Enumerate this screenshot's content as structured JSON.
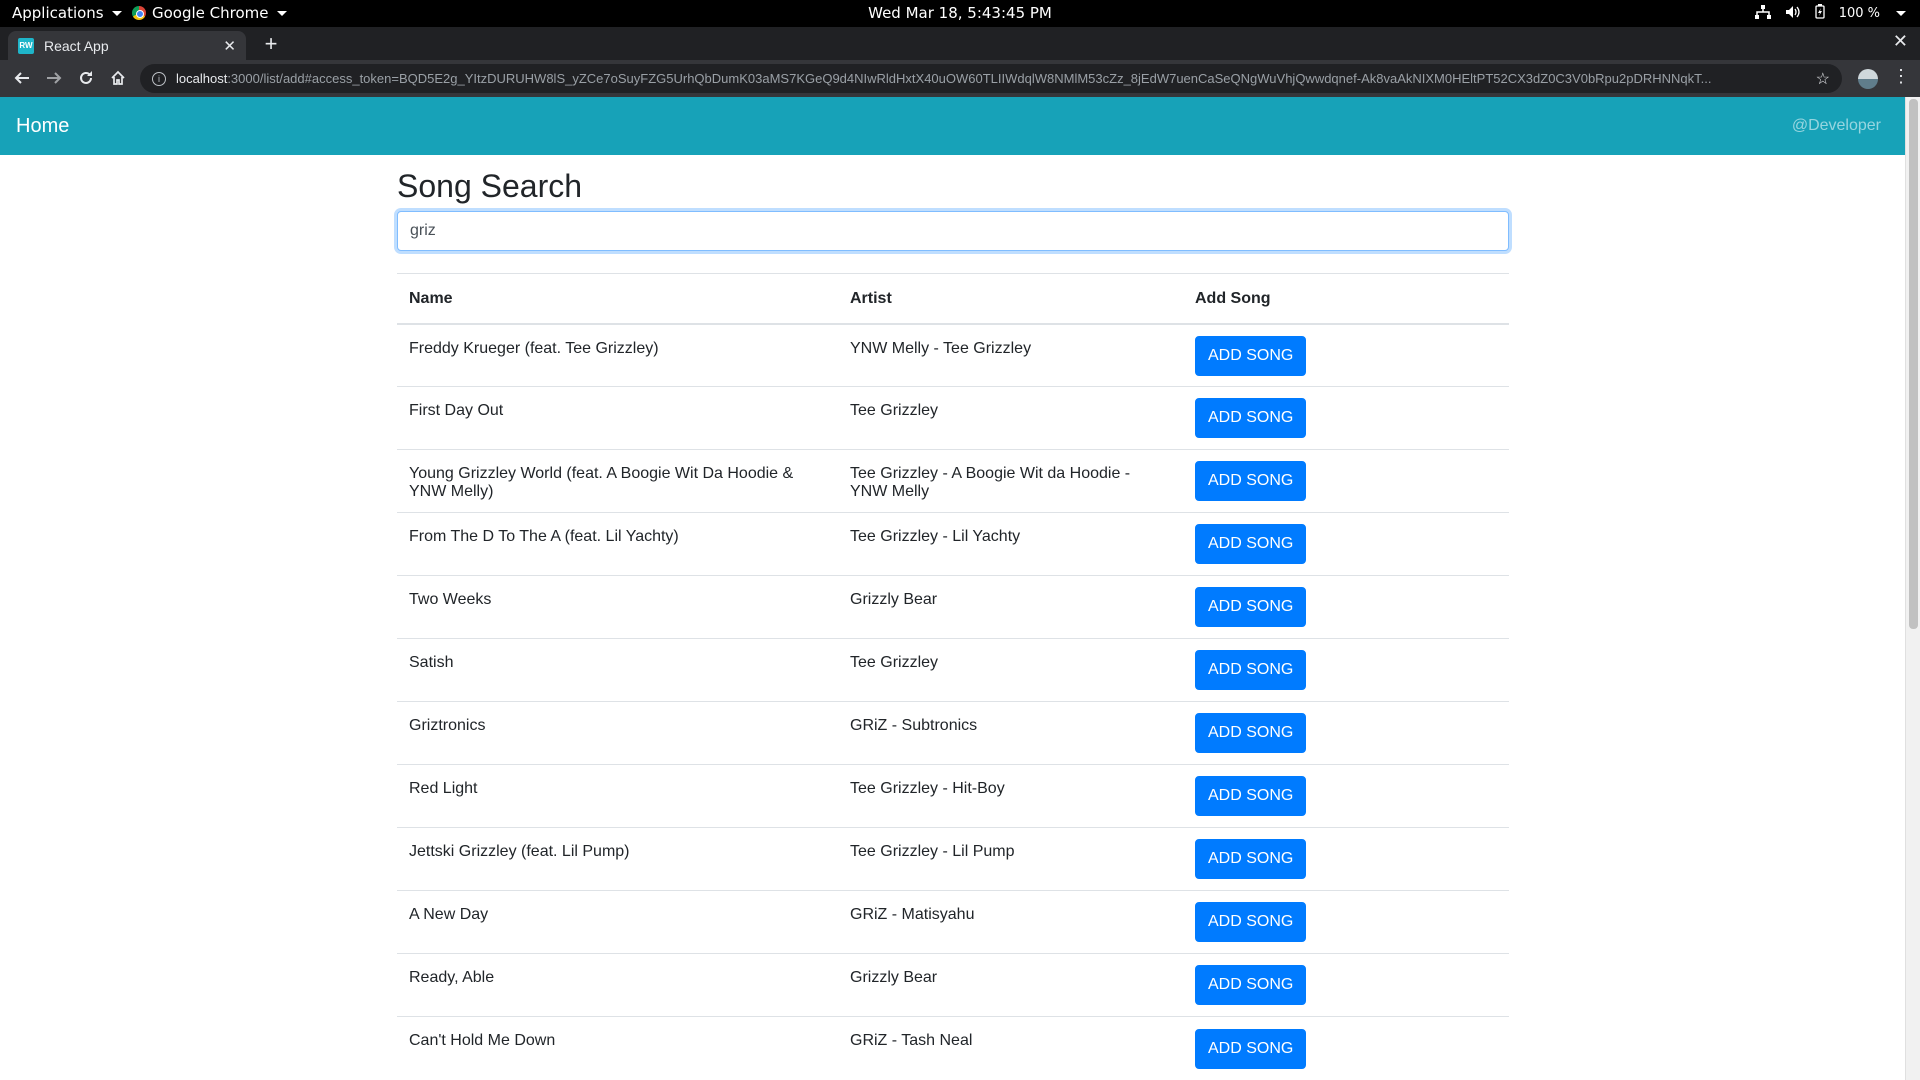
{
  "system": {
    "apps_menu": "Applications",
    "browser_menu": "Google Chrome",
    "clock": "Wed Mar 18,  5:43:45 PM",
    "battery": "100 %"
  },
  "browser": {
    "tab_title": "React App",
    "favicon_text": "RW",
    "url_host": "localhost",
    "url_path": ":3000/list/add#access_token=BQD5E2g_YItzDURUHW8lS_yZCe7oSuyFZG5UrhQbDumK03aMS7KGeQ9d4NIwRldHxtX40uOW60TLIIWdqlW8NMlM53cZz_8jEdW7uenCaSeQNgWuVhjQwwdqnef-Ak8vaAkNIXM0HEltPT52CX3dZ0C3V0bRpu2pDRHNNqkT..."
  },
  "navbar": {
    "brand": "Home",
    "user": "@Developer",
    "color": "#17a2b8"
  },
  "page": {
    "title": "Song Search",
    "search_value": "griz"
  },
  "table": {
    "headers": [
      "Name",
      "Artist",
      "Add Song"
    ],
    "button_label": "ADD SONG",
    "button_color": "#007bff",
    "rows": [
      {
        "name": "Freddy Krueger (feat. Tee Grizzley)",
        "artist": "YNW Melly - Tee Grizzley"
      },
      {
        "name": "First Day Out",
        "artist": "Tee Grizzley"
      },
      {
        "name": "Young Grizzley World (feat. A Boogie Wit Da Hoodie & YNW Melly)",
        "artist": "Tee Grizzley - A Boogie Wit da Hoodie - YNW Melly"
      },
      {
        "name": "From The D To The A (feat. Lil Yachty)",
        "artist": "Tee Grizzley - Lil Yachty"
      },
      {
        "name": "Two Weeks",
        "artist": "Grizzly Bear"
      },
      {
        "name": "Satish",
        "artist": "Tee Grizzley"
      },
      {
        "name": "Griztronics",
        "artist": "GRiZ - Subtronics"
      },
      {
        "name": "Red Light",
        "artist": "Tee Grizzley - Hit-Boy"
      },
      {
        "name": "Jettski Grizzley (feat. Lil Pump)",
        "artist": "Tee Grizzley - Lil Pump"
      },
      {
        "name": "A New Day",
        "artist": "GRiZ - Matisyahu"
      },
      {
        "name": "Ready, Able",
        "artist": "Grizzly Bear"
      },
      {
        "name": "Can't Hold Me Down",
        "artist": "GRiZ - Tash Neal"
      }
    ]
  }
}
